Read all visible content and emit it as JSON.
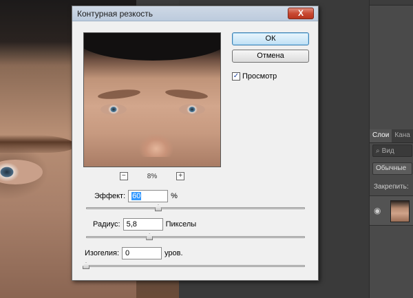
{
  "dialog": {
    "title": "Контурная резкость",
    "close_label": "X",
    "ok_label": "ОК",
    "cancel_label": "Отмена",
    "preview_label": "Просмотр",
    "preview_checked": true,
    "zoom": {
      "minus_label": "−",
      "plus_label": "+",
      "value": "8%"
    },
    "amount": {
      "label": "Эффект:",
      "value": "60",
      "unit": "%",
      "slider_fraction": 0.33
    },
    "radius": {
      "label": "Радиус:",
      "value": "5,8",
      "unit": "Пикселы",
      "slider_fraction": 0.29
    },
    "threshold": {
      "label": "Изогелия:",
      "value": "0",
      "unit": "уров.",
      "slider_fraction": 0.0
    }
  },
  "layers_panel": {
    "tabs": [
      "Слои",
      "Кана"
    ],
    "search_placeholder": "Вид",
    "blend_mode": "Обычные",
    "lock_label": "Закрепить:"
  }
}
